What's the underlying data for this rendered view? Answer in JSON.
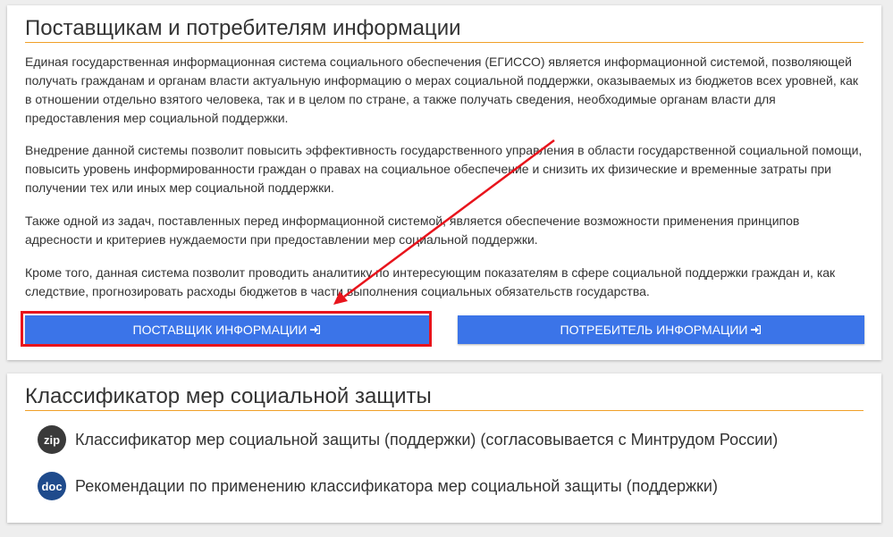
{
  "info_section": {
    "title": "Поставщикам и потребителям информации",
    "paragraphs": [
      "Единая государственная информационная система социального обеспечения (ЕГИССО) является информационной системой, позволяющей получать гражданам и органам власти актуальную информацию о мерах социальной поддержки, оказываемых из бюджетов всех уровней, как в отношении отдельно взятого человека, так и в целом по стране, а также получать сведения, необходимые органам власти для предоставления мер социальной поддержки.",
      "Внедрение данной системы позволит повысить эффективность государственного управления в области государственной социальной помощи, повысить уровень информированности граждан о правах на социальное обеспечение и снизить их физические и временные затраты при получении тех или иных мер социальной поддержки.",
      "Также одной из задач, поставленных перед информационной системой, является обеспечение возможности применения принципов адресности и критериев нуждаемости при предоставлении мер социальной поддержки.",
      "Кроме того, данная система позволит проводить аналитику по интересующим показателям в сфере социальной поддержки граждан и, как следствие, прогнозировать расходы бюджетов в части выполнения социальных обязательств государства."
    ],
    "supplier_button": "ПОСТАВЩИК ИНФОРМАЦИИ",
    "consumer_button": "ПОТРЕБИТЕЛЬ ИНФОРМАЦИИ"
  },
  "classifier_section": {
    "title": "Классификатор мер социальной защиты",
    "documents": [
      {
        "badge": "zip",
        "label": "Классификатор мер социальной защиты (поддержки) (согласовывается с Минтрудом России)",
        "badge_color": "#3a3a3a"
      },
      {
        "badge": "doc",
        "label": "Рекомендации по применению классификатора мер социальной защиты (поддержки)",
        "badge_color": "#1f4b8c"
      }
    ]
  },
  "colors": {
    "accent": "#f0a028",
    "button": "#3b74e8",
    "annotation": "#e8141c"
  }
}
